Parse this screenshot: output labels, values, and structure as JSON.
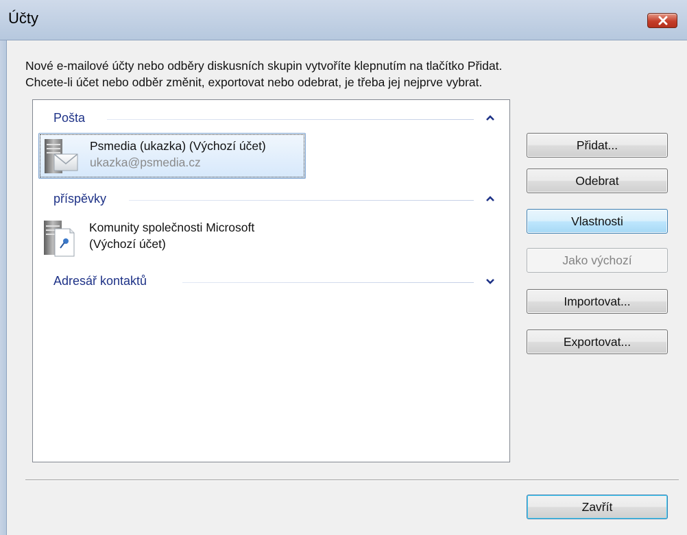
{
  "window": {
    "title": "Účty",
    "close_icon": "close-icon"
  },
  "intro": {
    "line1": "Nové e-mailové účty nebo odběry diskusních skupin vytvoříte klepnutím na tlačítko Přidat.",
    "line2": "Chcete-li účet nebo odběr změnit, exportovat nebo odebrat, je třeba jej nejprve vybrat."
  },
  "groups": {
    "mail": {
      "title": "Pošta",
      "expanded": true,
      "account": {
        "name": "Psmedia (ukazka) (Výchozí účet)",
        "email": "ukazka@psmedia.cz",
        "icon": "mail-server-icon",
        "selected": true
      }
    },
    "news": {
      "title": "příspěvky",
      "expanded": true,
      "account": {
        "name_line1": "Komunity společnosti Microsoft",
        "name_line2": "(Výchozí účet)",
        "icon": "news-server-icon"
      }
    },
    "contacts": {
      "title": "Adresář kontaktů",
      "expanded": false
    }
  },
  "buttons": {
    "add": "Přidat...",
    "remove": "Odebrat",
    "properties": "Vlastnosti",
    "set_default": "Jako výchozí",
    "import": "Importovat...",
    "export": "Exportovat...",
    "close": "Zavřít"
  },
  "colors": {
    "group_title": "#1e3287",
    "selection_border": "#7da2ce",
    "hot_button_border": "#3c7fb1",
    "close_button": "#c53e2a"
  }
}
